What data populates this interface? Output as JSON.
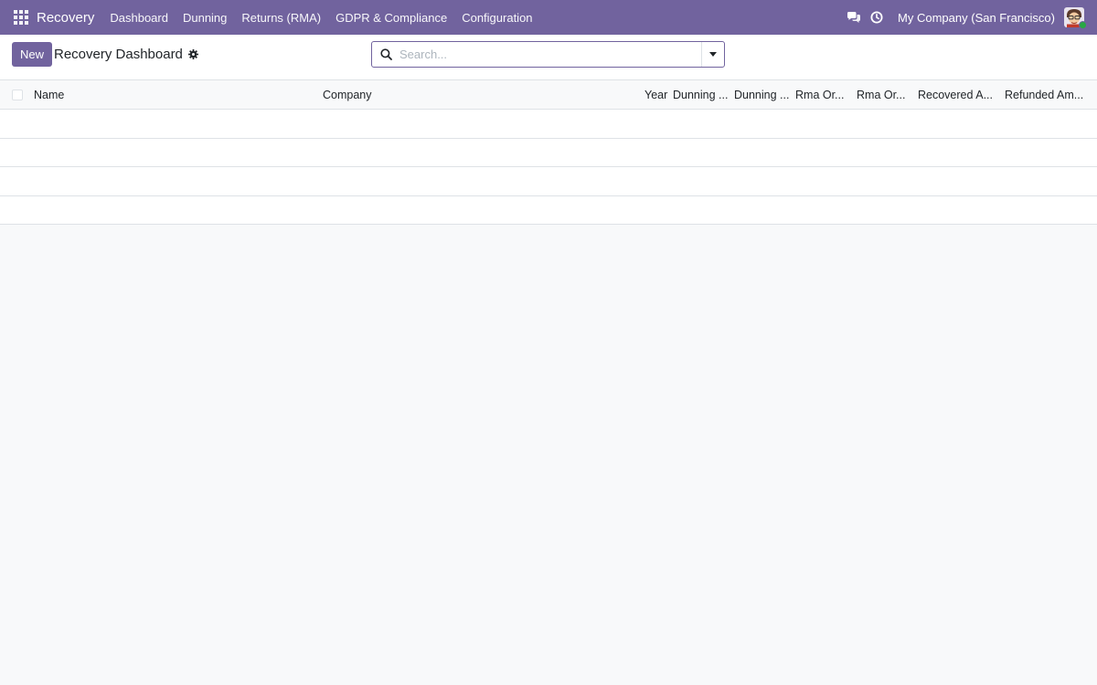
{
  "navbar": {
    "app_name": "Recovery",
    "menu": [
      {
        "label": "Dashboard"
      },
      {
        "label": "Dunning"
      },
      {
        "label": "Returns (RMA)"
      },
      {
        "label": "GDPR & Compliance"
      },
      {
        "label": "Configuration"
      }
    ],
    "company": "My Company (San Francisco)",
    "icons": {
      "apps": "grid-icon",
      "discuss": "chat-icon",
      "activity": "clock-icon",
      "avatar": "user-avatar"
    }
  },
  "control_panel": {
    "new_label": "New",
    "title": "Recovery Dashboard",
    "search_placeholder": "Search..."
  },
  "table": {
    "columns": [
      {
        "label": "Name"
      },
      {
        "label": "Company"
      },
      {
        "label": "Year"
      },
      {
        "label": "Dunning ..."
      },
      {
        "label": "Dunning ..."
      },
      {
        "label": "Rma Or..."
      },
      {
        "label": "Rma Or..."
      },
      {
        "label": "Recovered A..."
      },
      {
        "label": "Refunded Am..."
      }
    ],
    "rows": []
  },
  "colors": {
    "brand": "#71639e",
    "background": "#f8f9fa",
    "border": "#dee2e6"
  }
}
